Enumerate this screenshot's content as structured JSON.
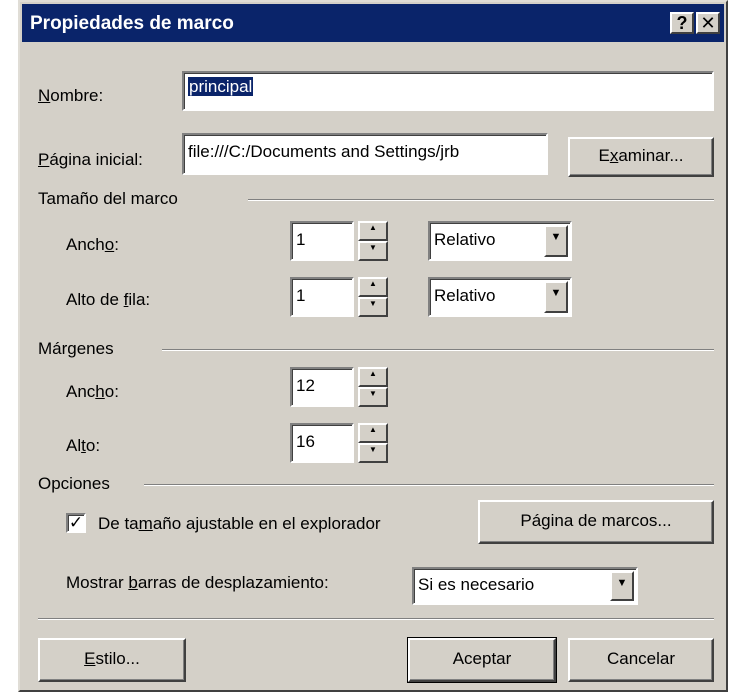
{
  "title": "Propiedades de marco",
  "titlebar_buttons": {
    "help": "?",
    "close": "✕"
  },
  "nombre": {
    "label_a": "N",
    "label_b": "ombre:",
    "value": "principal"
  },
  "pagina_inicial": {
    "label_a": "P",
    "label_b": "ágina inicial:",
    "value": "file:///C:/Documents and Settings/jrb",
    "browse_a": "E",
    "browse_b": "x",
    "browse_c": "aminar..."
  },
  "tamano": {
    "heading": "Tamaño del marco",
    "ancho": {
      "label_a": "Anch",
      "label_b": "o",
      "label_c": ":",
      "value": "1",
      "unit": "Relativo"
    },
    "alto": {
      "label_a": "Alto de ",
      "label_b": "f",
      "label_c": "ila:",
      "value": "1",
      "unit": "Relativo"
    }
  },
  "margenes": {
    "heading": "Márgenes",
    "ancho": {
      "label_a": "Anc",
      "label_b": "h",
      "label_c": "o:",
      "value": "12"
    },
    "alto": {
      "label_a": "Al",
      "label_b": "t",
      "label_c": "o:",
      "value": "16"
    }
  },
  "opciones": {
    "heading": "Opciones",
    "resizable": {
      "label_a": "De ta",
      "label_b": "m",
      "label_c": "año ajustable en el explorador",
      "checked": true
    },
    "frames_page_button": "Página de marcos...",
    "scrollbars": {
      "label_a": "Mostrar ",
      "label_b": "b",
      "label_c": "arras de desplazamiento:",
      "value": "Si es necesario"
    }
  },
  "footer": {
    "style_a": "E",
    "style_b": "stilo...",
    "ok": "Aceptar",
    "cancel": "Cancelar"
  },
  "icons": {
    "spin_up": "▲",
    "spin_down": "▼",
    "dropdown": "▼",
    "check": "✓"
  }
}
